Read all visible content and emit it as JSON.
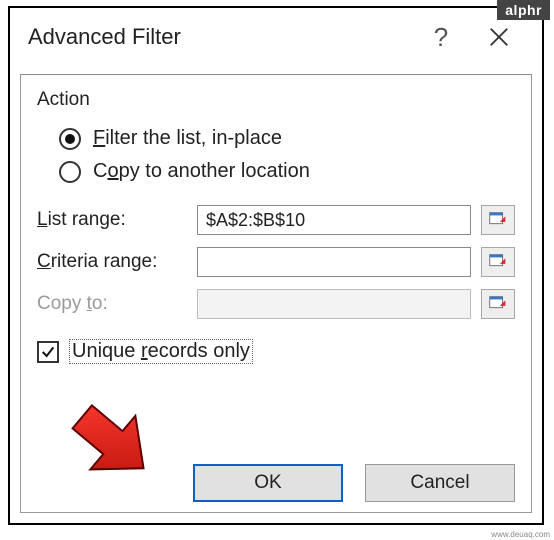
{
  "titlebar": {
    "title": "Advanced Filter",
    "help_tooltip": "Help",
    "close_tooltip": "Close"
  },
  "action": {
    "section_label": "Action",
    "filter_in_place": {
      "prefix": "",
      "u": "F",
      "rest": "ilter the list, in-place",
      "checked": true
    },
    "copy_to": {
      "prefix": "C",
      "u": "o",
      "rest": "py to another location",
      "checked": false
    }
  },
  "fields": {
    "list_range": {
      "prefix": "",
      "u": "L",
      "rest": "ist range:",
      "value": "$A$2:$B$10",
      "enabled": true
    },
    "criteria_range": {
      "prefix": "",
      "u": "C",
      "rest": "riteria range:",
      "value": "",
      "enabled": true
    },
    "copy_to": {
      "prefix": "Copy ",
      "u": "t",
      "rest": "o:",
      "value": "",
      "enabled": false
    }
  },
  "unique": {
    "prefix": "Unique ",
    "u": "r",
    "rest": "ecords only",
    "checked": true
  },
  "buttons": {
    "ok": "OK",
    "cancel": "Cancel"
  },
  "watermark": {
    "top": "alphr",
    "bottom": "www.deuaq.com"
  }
}
